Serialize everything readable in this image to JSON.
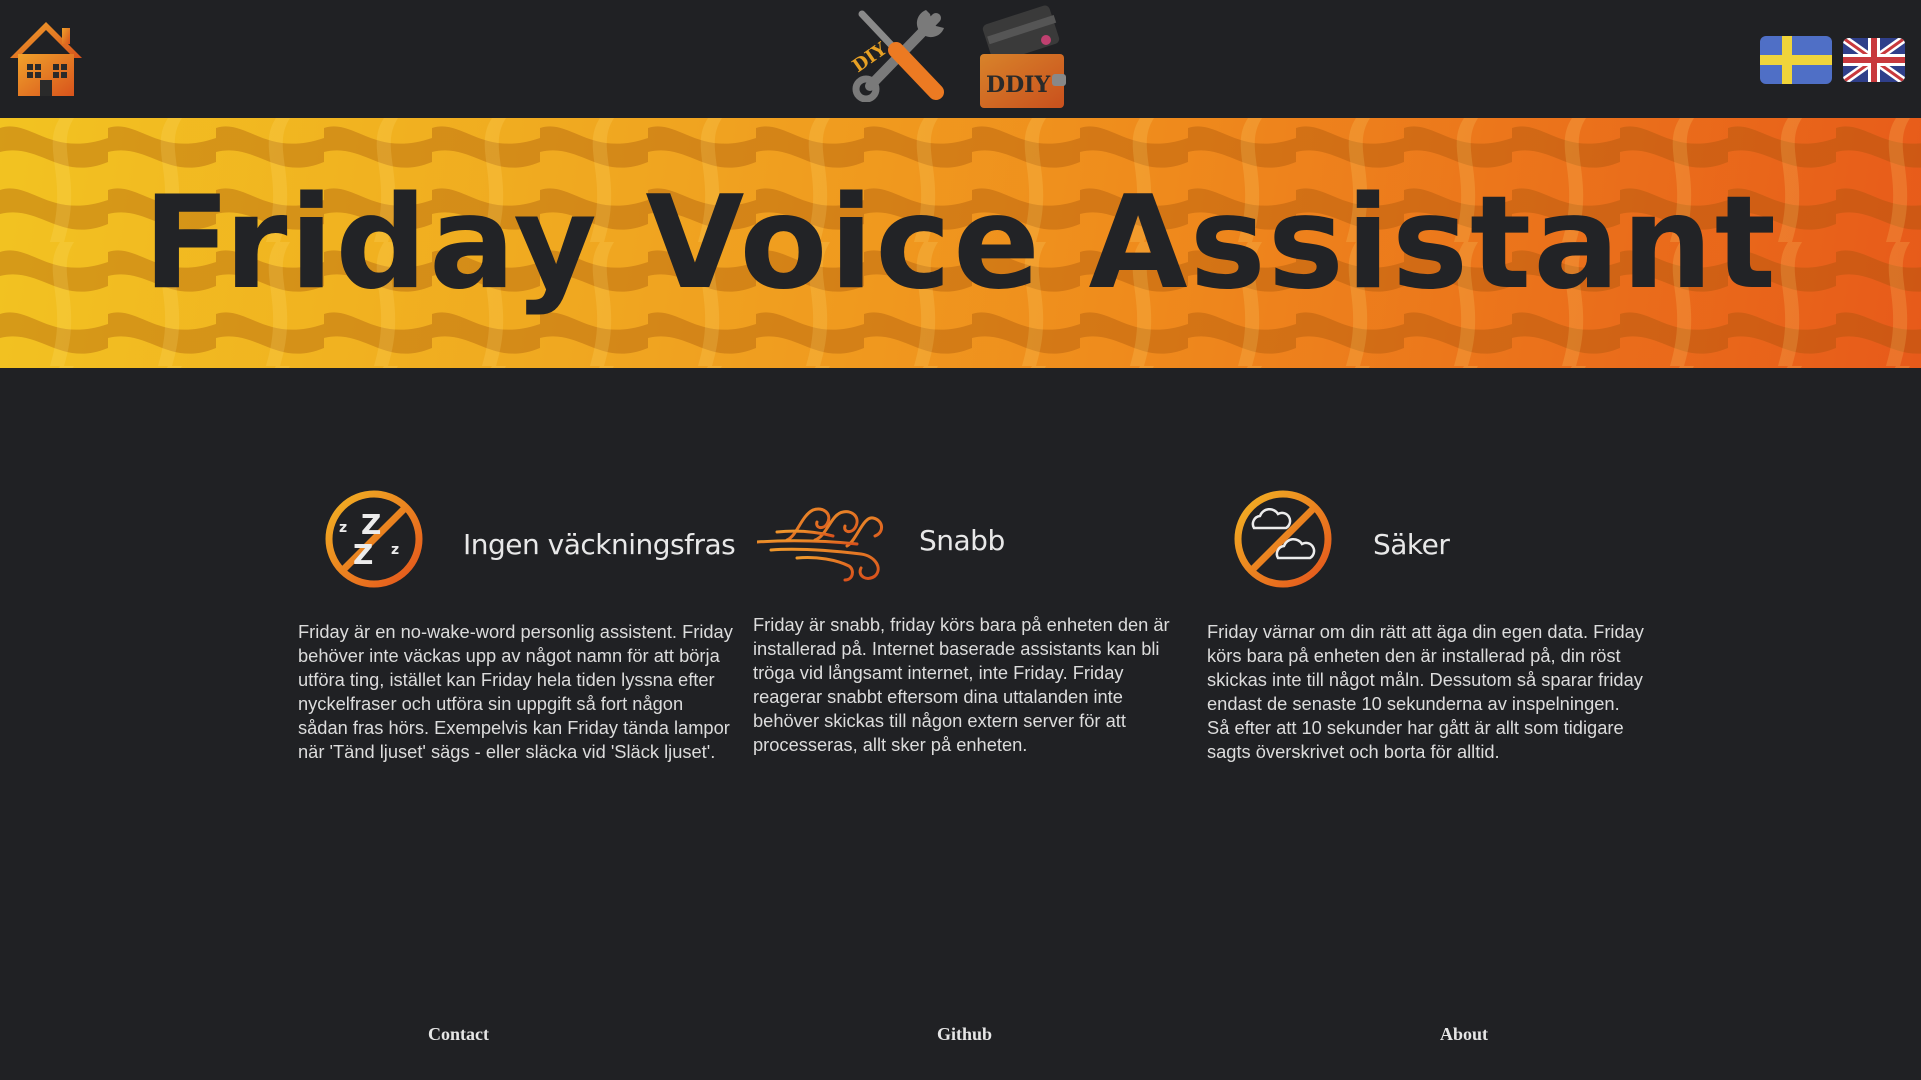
{
  "header": {
    "home_icon": "home-icon",
    "diy_logo_text": "DIY",
    "ddiy_logo_text": "DDIY",
    "languages": [
      {
        "name": "Svenska",
        "icon": "sweden-flag-icon"
      },
      {
        "name": "English",
        "icon": "uk-flag-icon"
      }
    ]
  },
  "hero": {
    "title": "Friday Voice Assistant",
    "gradient_colors": [
      "#f2c321",
      "#ef8a1c",
      "#e75a1a"
    ]
  },
  "features": [
    {
      "icon": "no-sleep-icon",
      "title": "Ingen väckningsfras",
      "text": "Friday är en no-wake-word personlig assistent. Friday behöver inte väckas upp av något namn för att börja utföra ting, istället kan Friday hela tiden lyssna efter nyckelfraser och utföra sin uppgift så fort någon sådan fras hörs. Exempelvis kan Friday tända lampor när 'Tänd ljuset' sägs - eller släcka vid 'Släck ljuset'."
    },
    {
      "icon": "wind-icon",
      "title": "Snabb",
      "text": "Friday är snabb, friday körs bara på enheten den är installerad på. Internet baserade assistants kan bli tröga vid långsamt internet, inte Friday. Friday reagerar snabbt eftersom dina uttalanden inte behöver skickas till någon extern server för att processeras, allt sker på enheten."
    },
    {
      "icon": "no-cloud-icon",
      "title": "Säker",
      "text": "Friday värnar om din rätt att äga din egen data. Friday körs bara på enheten den är installerad på, din röst skickas inte till något måln. Dessutom så sparar friday endast de senaste 10 sekunderna av inspelningen. Så efter att 10 sekunder har gått är allt som tidigare sagts överskrivet och borta för alltid."
    }
  ],
  "footer": {
    "links": [
      "Contact",
      "Github",
      "About"
    ]
  },
  "colors": {
    "background": "#202124",
    "accent_orange": "#ef7d1f",
    "accent_yellow": "#f2c321"
  }
}
